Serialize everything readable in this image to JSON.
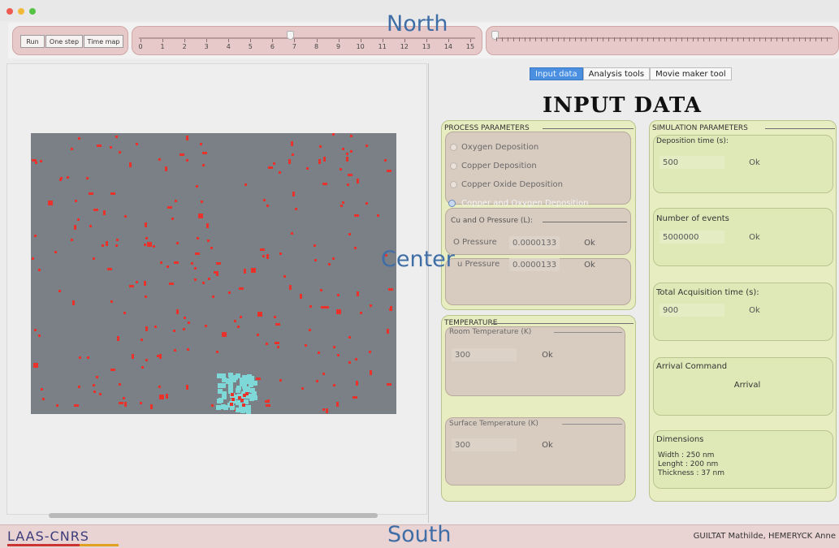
{
  "regions": {
    "north": "North",
    "center": "Center",
    "south": "South"
  },
  "controls": {
    "run": "Run",
    "one_step": "One step",
    "time_map": "Time map"
  },
  "slider": {
    "ticks": [
      "0",
      "1",
      "2",
      "3",
      "4",
      "5",
      "6",
      "7",
      "8",
      "9",
      "10",
      "11",
      "12",
      "13",
      "14",
      "15"
    ],
    "value": 7
  },
  "tabs": [
    "Input data",
    "Analysis tools",
    "Movie maker tool"
  ],
  "active_tab": 0,
  "heading": "INPUT DATA",
  "process": {
    "title": "PROCESS PARAMETERS",
    "options": [
      "Oxygen Deposition",
      "Copper Deposition",
      "Copper Oxide Deposition",
      "Copper and Oxygen Deposition"
    ],
    "selected": 3,
    "pressure_title": "Cu and O Pressure (L):",
    "o_label": "O Pressure",
    "o_value": "0.0000133",
    "cu_label": "u Pressure",
    "cu_value": "0.0000133",
    "ok": "Ok"
  },
  "temperature": {
    "title": "TEMPERATURE",
    "room_title": "Room Temperature (K)",
    "room_value": "300",
    "surface_title": "Surface Temperature (K)",
    "surface_value": "300",
    "ok": "Ok"
  },
  "simulation": {
    "title": "SIMULATION PARAMETERS",
    "deposition_title": "Deposition time (s):",
    "deposition_value": "500",
    "events_title": "Number of events",
    "events_value": "5000000",
    "acq_title": "Total Acquisition time (s):",
    "acq_value": "900",
    "arrival_title": "Arrival Command",
    "arrival_button": "Arrival",
    "dimensions_title": "Dimensions",
    "width": "Width : 250 nm",
    "length": "Lenght : 200 nm",
    "thickness": "Thickness : 37 nm",
    "ok": "Ok"
  },
  "footer": {
    "logo": "LAAS-CNRS",
    "authors": "GUILTAT Mathilde, HEMERYCK Anne"
  },
  "colors": {
    "atom": "#e8322b",
    "cluster": "#7fd8d8",
    "surface": "#7b7f86"
  }
}
